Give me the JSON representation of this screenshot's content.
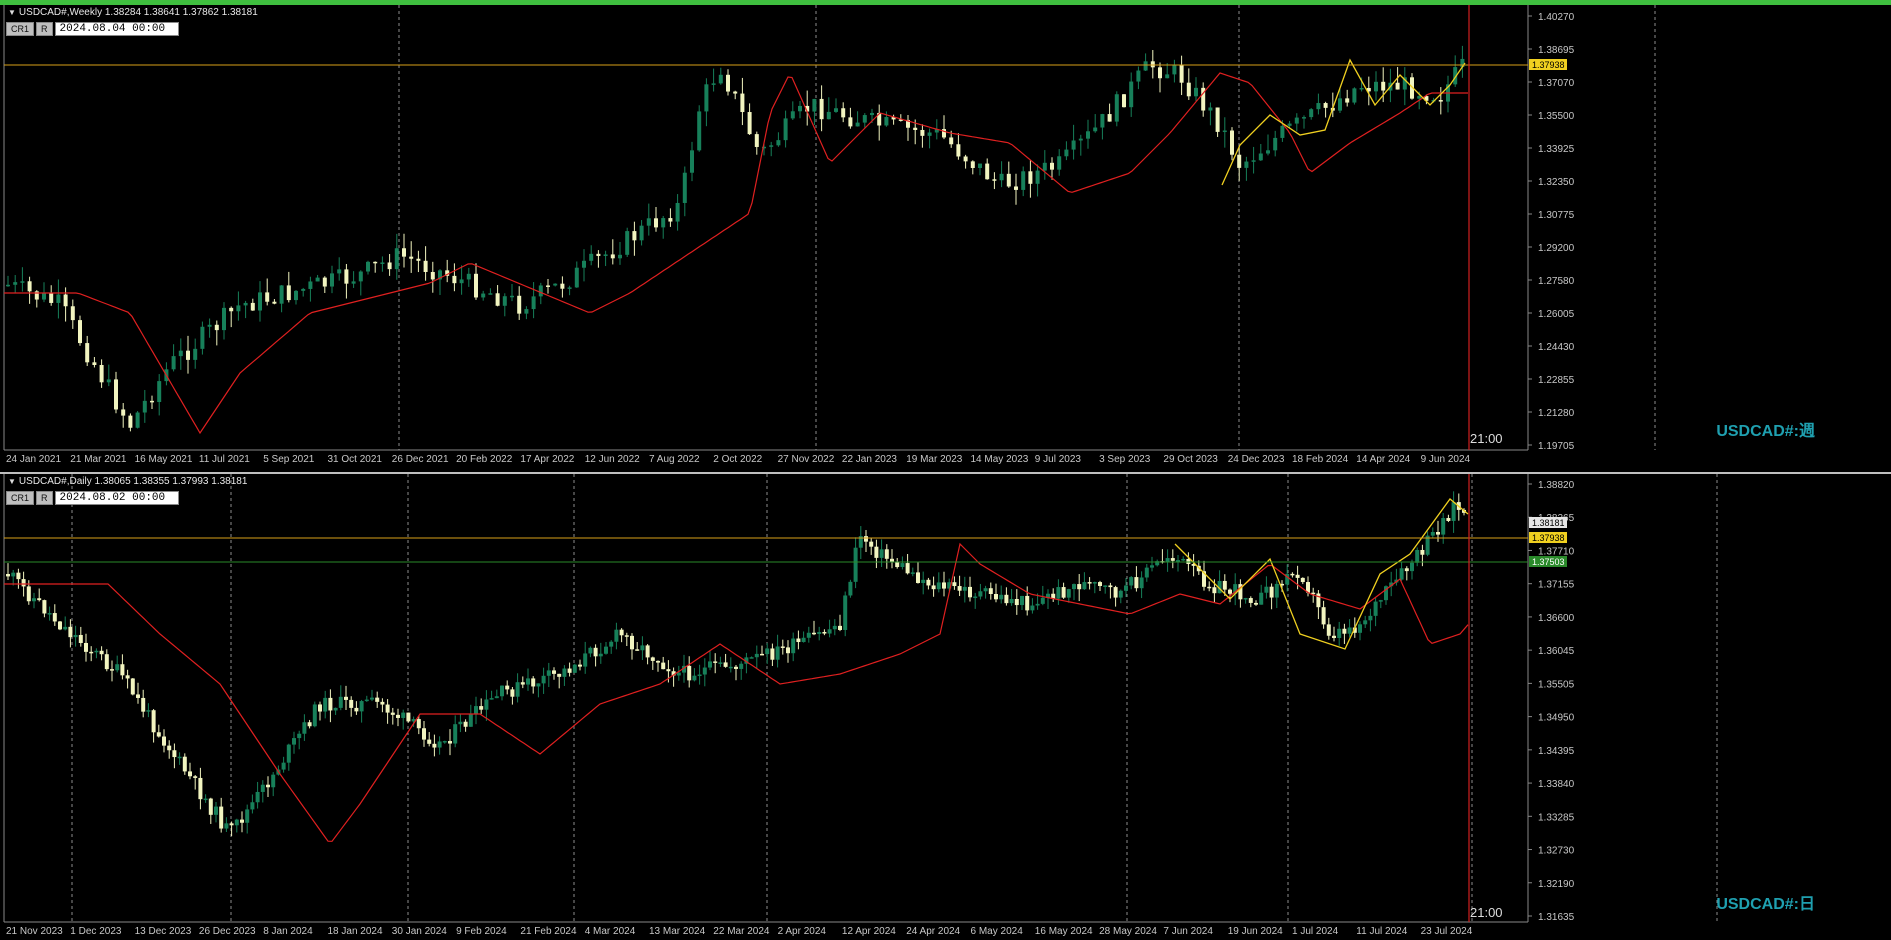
{
  "colors": {
    "bull": "#17805a",
    "bear": "#f2f5c0",
    "ma": "#e02020",
    "zigzag": "#f0d020",
    "hline_gold": "#d8a018",
    "hline_green": "#2a8a2a",
    "vline_red": "#d02020",
    "grid": "#b0b0b0",
    "axis_text": "#c8c8c8"
  },
  "top": {
    "header": "USDCAD#,Weekly  1.38284 1.38641 1.37862 1.38181",
    "chip1": "CR1",
    "chip2": "R",
    "date_value": "2024.08.04 00:00",
    "symbol_label": "USDCAD#:週",
    "time_label": "21:00",
    "price_ticks": [
      "1.40270",
      "1.38695",
      "1.37070",
      "1.35500",
      "1.33925",
      "1.32350",
      "1.30775",
      "1.29200",
      "1.27580",
      "1.26005",
      "1.24430",
      "1.22855",
      "1.21280",
      "1.19705"
    ],
    "hline_label": "1.37938",
    "date_ticks": [
      "24 Jan 2021",
      "21 Mar 2021",
      "16 May 2021",
      "11 Jul 2021",
      "5 Sep 2021",
      "31 Oct 2021",
      "26 Dec 2021",
      "20 Feb 2022",
      "17 Apr 2022",
      "12 Jun 2022",
      "7 Aug 2022",
      "2 Oct 2022",
      "27 Nov 2022",
      "22 Jan 2023",
      "19 Mar 2023",
      "14 May 2023",
      "9 Jul 2023",
      "3 Sep 2023",
      "29 Oct 2023",
      "24 Dec 2023",
      "18 Feb 2024",
      "14 Apr 2024",
      "9 Jun 2024"
    ]
  },
  "bottom": {
    "header": "USDCAD#,Daily  1.38065 1.38355 1.37993 1.38181",
    "chip1": "CR1",
    "chip2": "R",
    "date_value": "2024.08.02 00:00",
    "symbol_label": "USDCAD#:日",
    "time_label": "21:00",
    "price_ticks": [
      "1.38820",
      "1.38265",
      "1.37710",
      "1.37155",
      "1.36600",
      "1.36045",
      "1.35505",
      "1.34950",
      "1.34395",
      "1.33840",
      "1.33285",
      "1.32730",
      "1.32190",
      "1.31635"
    ],
    "hline_gold_label": "1.37938",
    "hline_green_label": "1.37503",
    "price_label": "1.38181",
    "date_ticks": [
      "21 Nov 2023",
      "1 Dec 2023",
      "13 Dec 2023",
      "26 Dec 2023",
      "8 Jan 2024",
      "18 Jan 2024",
      "30 Jan 2024",
      "9 Feb 2024",
      "21 Feb 2024",
      "4 Mar 2024",
      "13 Mar 2024",
      "22 Mar 2024",
      "2 Apr 2024",
      "12 Apr 2024",
      "24 Apr 2024",
      "6 May 2024",
      "16 May 2024",
      "28 May 2024",
      "7 Jun 2024",
      "19 Jun 2024",
      "1 Jul 2024",
      "11 Jul 2024",
      "23 Jul 2024"
    ]
  }
}
